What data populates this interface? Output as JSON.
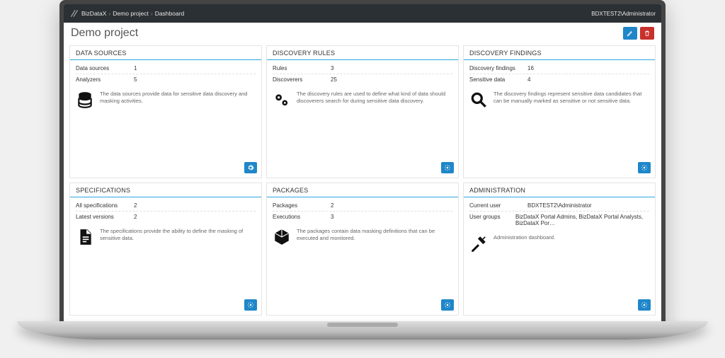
{
  "header": {
    "brand": "BizDataX",
    "crumb1": "Demo project",
    "crumb2": "Dashboard",
    "user": "BDXTEST2\\Administrator"
  },
  "page": {
    "title": "Demo project"
  },
  "cards": {
    "ds": {
      "title": "DATA SOURCES",
      "r1k": "Data sources",
      "r1v": "1",
      "r2k": "Analyzers",
      "r2v": "5",
      "desc": "The data sources provide data for sensitive data discovery and masking activities."
    },
    "dr": {
      "title": "DISCOVERY RULES",
      "r1k": "Rules",
      "r1v": "3",
      "r2k": "Discoverers",
      "r2v": "25",
      "desc": "The discovery rules are used to define what kind of data should discoverers search for during sensitive data discovery."
    },
    "df": {
      "title": "DISCOVERY FINDINGS",
      "r1k": "Discovery findings",
      "r1v": "16",
      "r2k": "Sensitive data",
      "r2v": "4",
      "desc": "The discovery findings represent sensitive data candidates that can be manually marked as sensitive or not sensitive data."
    },
    "sp": {
      "title": "SPECIFICATIONS",
      "r1k": "All specifications",
      "r1v": "2",
      "r2k": "Latest versions",
      "r2v": "2",
      "desc": "The specifications provide the ability to define the masking of sensitive data."
    },
    "pk": {
      "title": "PACKAGES",
      "r1k": "Packages",
      "r1v": "2",
      "r2k": "Executions",
      "r2v": "3",
      "desc": "The packages contain data masking definitions that can be executed and monitored."
    },
    "ad": {
      "title": "ADMINISTRATION",
      "r1k": "Current user",
      "r1v": "BDXTEST2\\Administrator",
      "r2k": "User groups",
      "r2v": "BizDataX Portal Admins, BizDataX Portal Analysts, BizDataX Por…",
      "desc": "Administration dashboard."
    }
  }
}
